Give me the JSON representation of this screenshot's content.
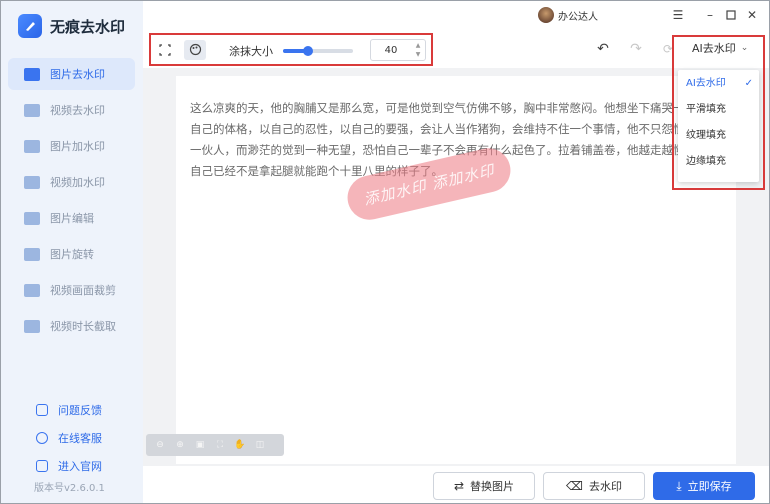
{
  "app": {
    "title": "无痕去水印"
  },
  "sidebar": {
    "items": [
      {
        "label": "图片去水印",
        "active": true
      },
      {
        "label": "视频去水印",
        "active": false
      },
      {
        "label": "图片加水印",
        "active": false
      },
      {
        "label": "视频加水印",
        "active": false
      },
      {
        "label": "图片编辑",
        "active": false
      },
      {
        "label": "图片旋转",
        "active": false
      },
      {
        "label": "视频画面裁剪",
        "active": false
      },
      {
        "label": "视频时长截取",
        "active": false
      }
    ],
    "footer": [
      {
        "label": "问题反馈",
        "icon": "feedback-icon"
      },
      {
        "label": "在线客服",
        "icon": "headset-icon"
      },
      {
        "label": "进入官网",
        "icon": "website-icon"
      }
    ],
    "version": "版本号v2.6.0.1"
  },
  "titlebar": {
    "user_name": "办公达人",
    "menu_icon": "menu-icon",
    "minimize_icon": "minimize-icon",
    "maximize_icon": "maximize-icon",
    "close_icon": "close-icon"
  },
  "toolbar": {
    "rect_select_icon": "rect-select-icon",
    "brush_icon": "brush-icon",
    "brush_size_label": "涂抹大小",
    "brush_size_value": "40",
    "brush_slider_level": 0.35,
    "undo_icon": "undo-icon",
    "redo_icon": "redo-icon",
    "reset_icon": "reset-icon"
  },
  "mode": {
    "selected": "AI去水印",
    "options": [
      {
        "label": "AI去水印",
        "selected": true
      },
      {
        "label": "平滑填充",
        "selected": false
      },
      {
        "label": "纹理填充",
        "selected": false
      },
      {
        "label": "边缘填充",
        "selected": false
      }
    ]
  },
  "document": {
    "lines": [
      "这么凉爽的天，他的胸脯又是那么宽，可是他觉到空气仿佛不够，胸中非常憋闷。他想坐下痛哭一",
      "自己的体格，以自己的忍性，以自己的要强，会让人当作猪狗，会维持不住一个事情，他不只怨恨",
      "一伙人，而渺茫的觉到一种无望，恐怕自己一辈子不会再有什么起色了。拉着铺盖卷，他越走越慢",
      "自己已经不是拿起腿就能跑个十里八里的样子了。"
    ],
    "watermark_text": "添加水印 添加水印"
  },
  "zoom_controls": [
    "zoom-out-icon",
    "zoom-in-icon",
    "fit-icon",
    "fullscreen-icon",
    "hand-icon",
    "compare-icon"
  ],
  "actions": {
    "replace_label": "替换图片",
    "remove_label": "去水印",
    "save_label": "立即保存"
  },
  "colors": {
    "accent": "#2f6be8",
    "highlight_border": "#d93a3a",
    "watermark": "#ec7882"
  }
}
